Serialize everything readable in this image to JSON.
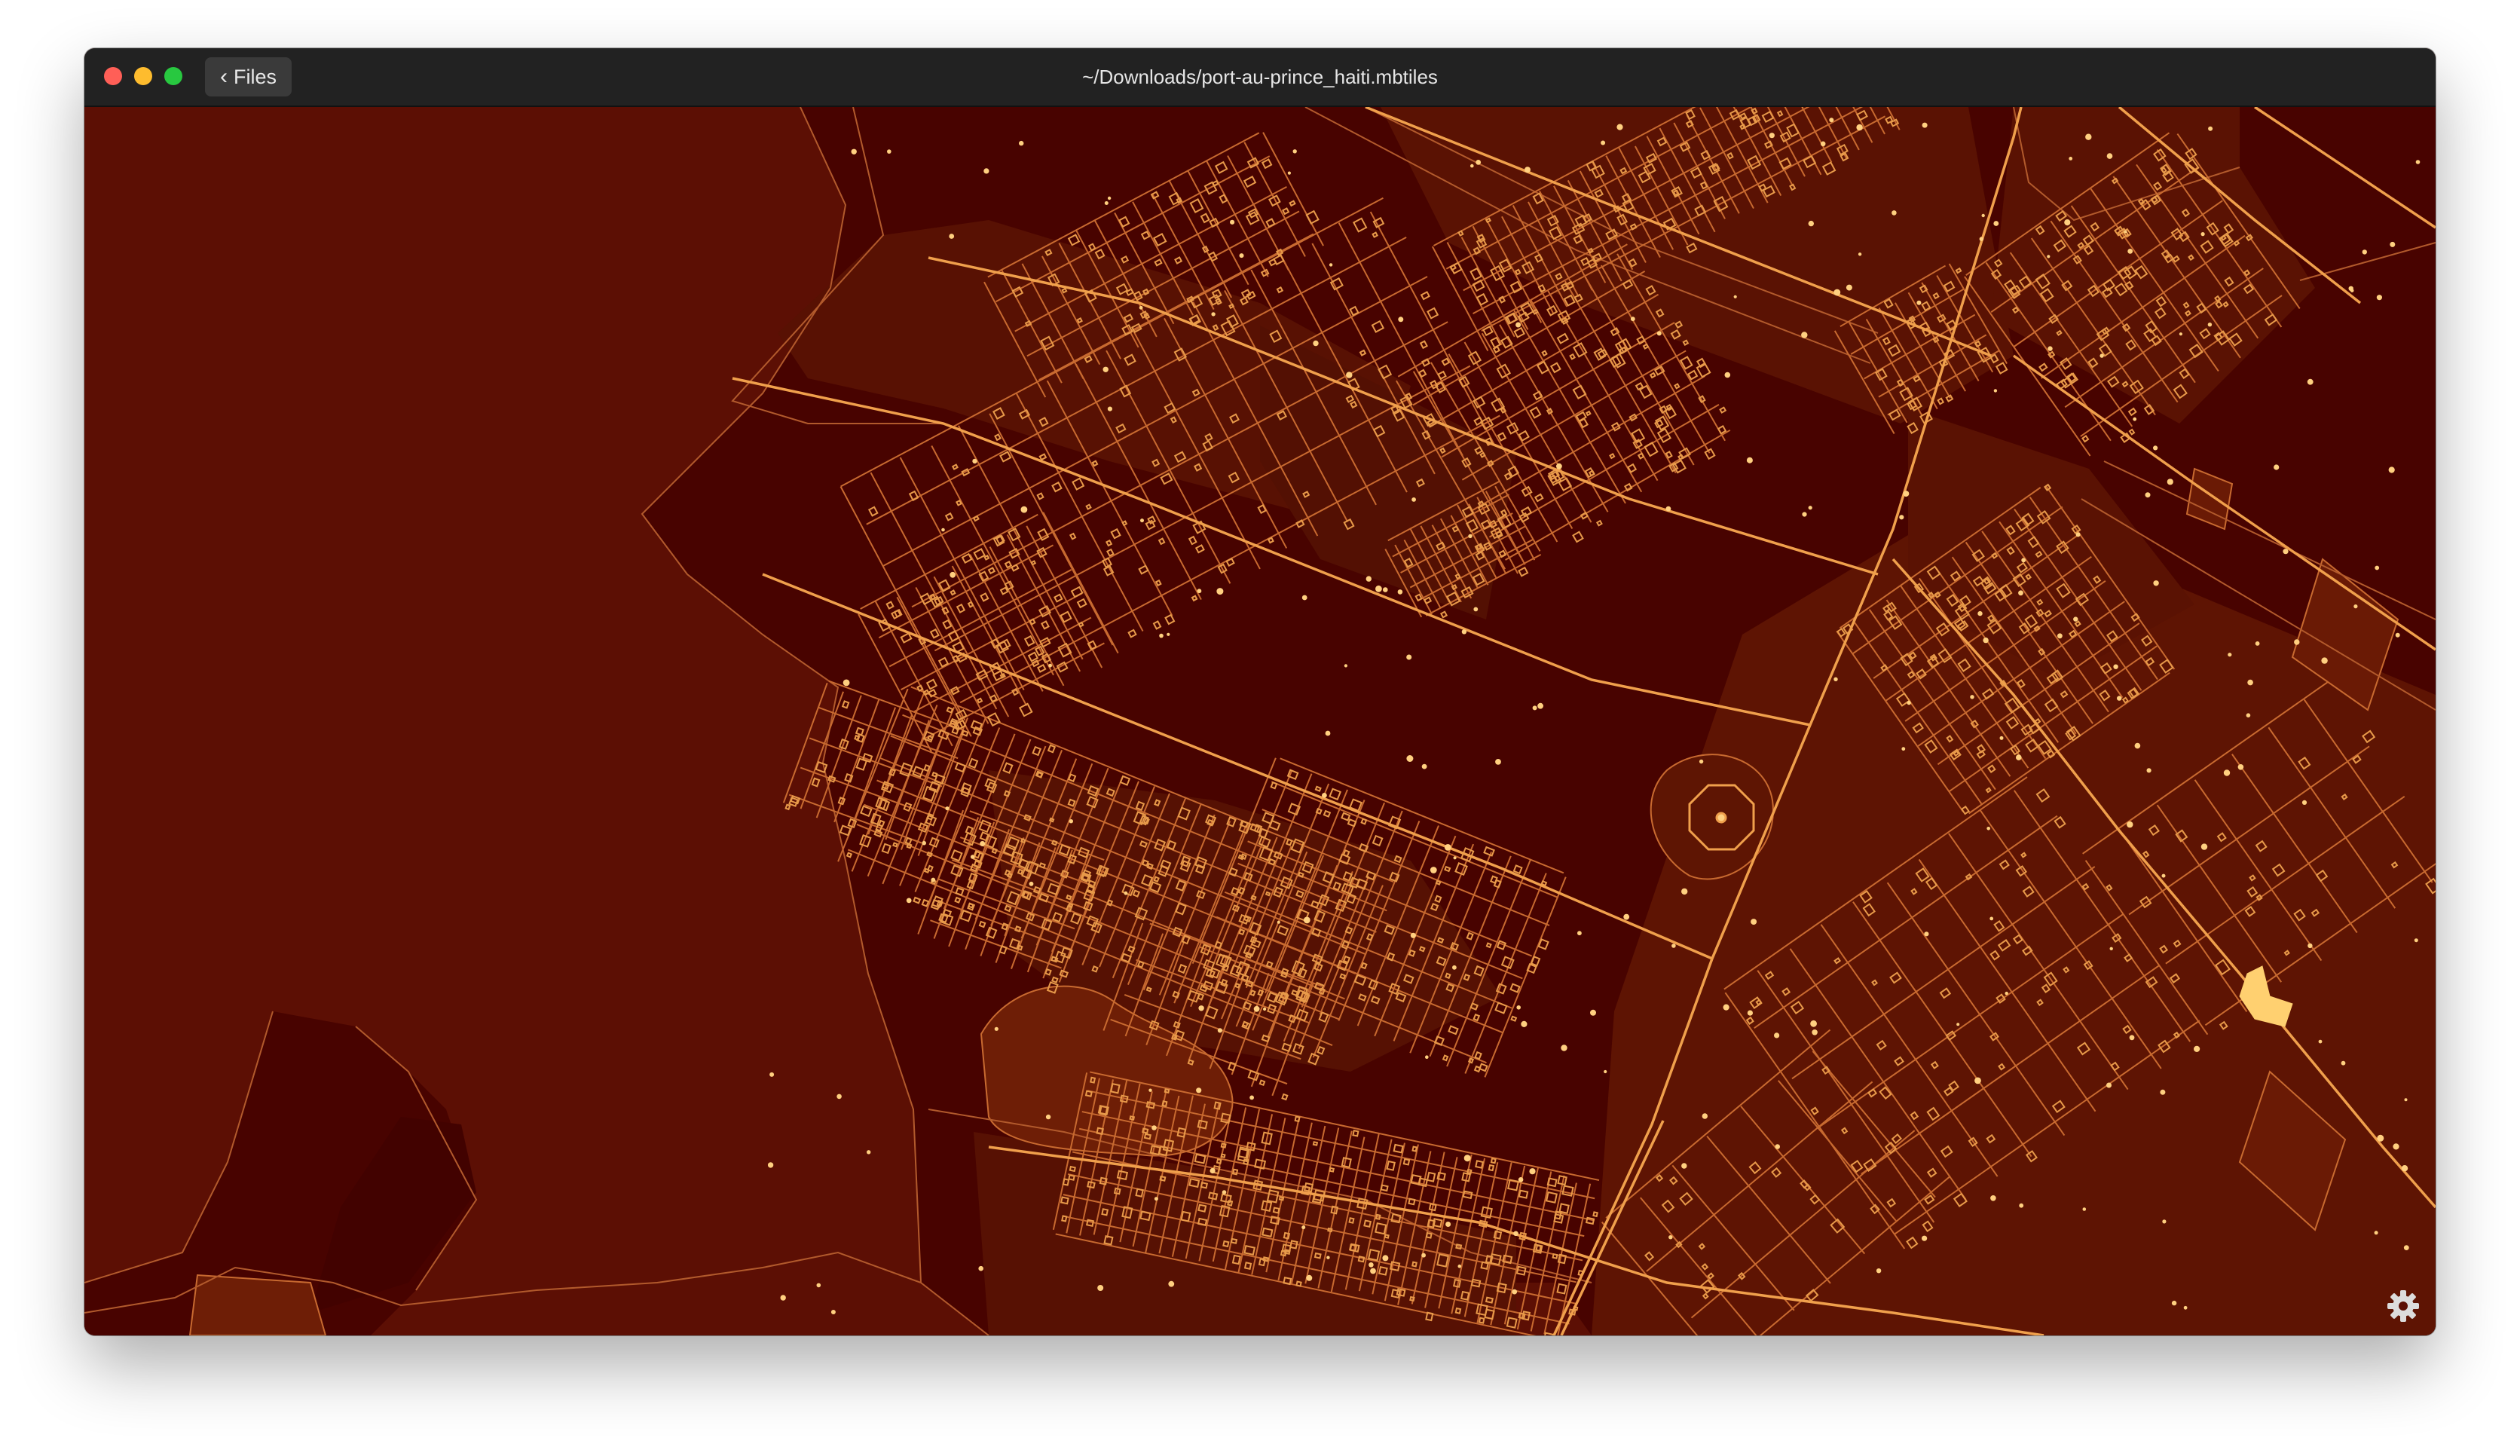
{
  "window": {
    "title": "~/Downloads/port-au-prince_haiti.mbtiles",
    "back_button_label": "Files"
  },
  "map": {
    "style": "dark",
    "colors": {
      "water": "#5c0f04",
      "land_dark": "#480300",
      "land_mid": "#611503",
      "park": "#6e1e06",
      "road_major": "#f0a04c",
      "road_minor": "#c86a30",
      "building": "#e89a4a",
      "poi": "#ffd080"
    },
    "icons": {
      "settings": "gear-icon",
      "back": "chevron-left-icon"
    }
  }
}
